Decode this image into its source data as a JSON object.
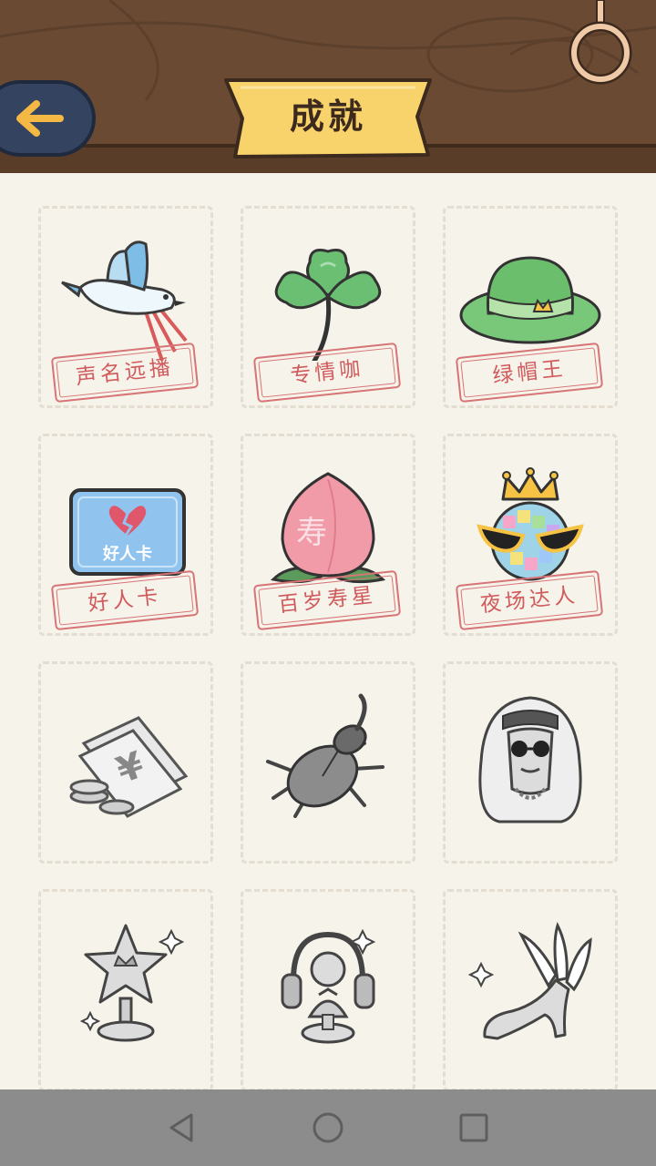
{
  "header": {
    "title": "成就",
    "back_icon": "arrow-left-icon",
    "ring_icon": "ring-icon"
  },
  "achievements": [
    {
      "name": "声名远播",
      "icon": "bird-icon",
      "unlocked": true
    },
    {
      "name": "专情咖",
      "icon": "clover-icon",
      "unlocked": true
    },
    {
      "name": "绿帽王",
      "icon": "green-hat-icon",
      "unlocked": true
    },
    {
      "name": "好人卡",
      "icon": "card-icon",
      "unlocked": true,
      "card_text": "好人卡"
    },
    {
      "name": "百岁寿星",
      "icon": "peach-icon",
      "unlocked": true,
      "peach_text": "寿"
    },
    {
      "name": "夜场达人",
      "icon": "disco-ball-icon",
      "unlocked": true
    },
    {
      "name": "",
      "icon": "money-icon",
      "unlocked": false,
      "money_text": "¥"
    },
    {
      "name": "",
      "icon": "beetle-icon",
      "unlocked": false
    },
    {
      "name": "",
      "icon": "sheikh-icon",
      "unlocked": false
    },
    {
      "name": "",
      "icon": "star-trophy-icon",
      "unlocked": false
    },
    {
      "name": "",
      "icon": "dj-trophy-icon",
      "unlocked": false
    },
    {
      "name": "",
      "icon": "winged-heel-icon",
      "unlocked": false
    }
  ],
  "navbar": {
    "back": "nav-back-icon",
    "home": "nav-home-icon",
    "recents": "nav-recents-icon"
  }
}
